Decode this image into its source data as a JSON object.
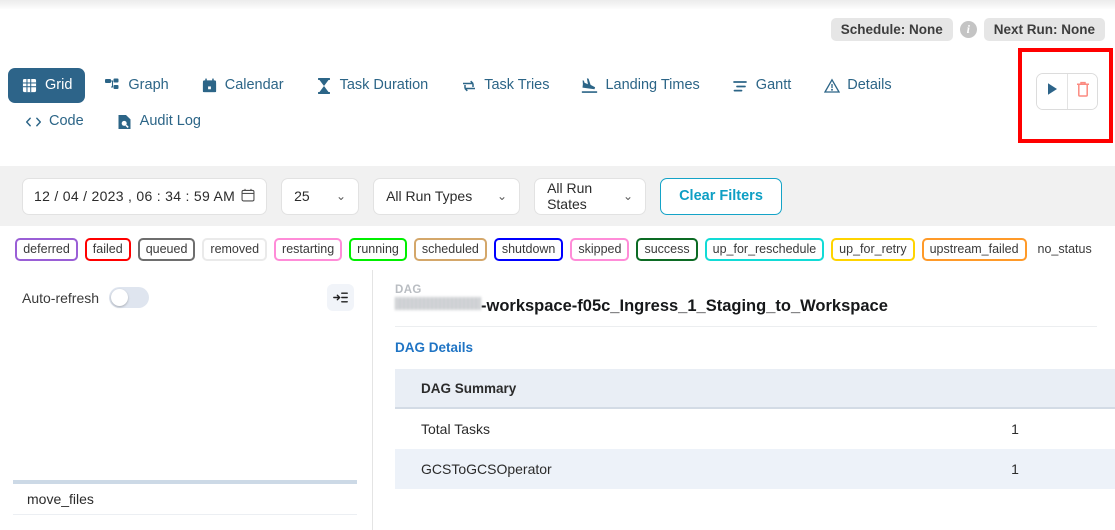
{
  "header": {
    "schedule_badge": "Schedule: None",
    "info_icon": "info-icon",
    "next_run_badge": "Next Run: None"
  },
  "nav": {
    "tabs": [
      {
        "label": "Grid",
        "icon": "grid-icon",
        "active": true
      },
      {
        "label": "Graph",
        "icon": "graph-icon",
        "active": false
      },
      {
        "label": "Calendar",
        "icon": "calendar-icon",
        "active": false
      },
      {
        "label": "Task Duration",
        "icon": "hourglass-icon",
        "active": false
      },
      {
        "label": "Task Tries",
        "icon": "retry-icon",
        "active": false
      },
      {
        "label": "Landing Times",
        "icon": "landing-icon",
        "active": false
      },
      {
        "label": "Gantt",
        "icon": "gantt-icon",
        "active": false
      },
      {
        "label": "Details",
        "icon": "warning-triangle-icon",
        "active": false
      }
    ],
    "tabs_row2": [
      {
        "label": "Code",
        "icon": "code-icon",
        "active": false
      },
      {
        "label": "Audit Log",
        "icon": "audit-log-icon",
        "active": false
      }
    ]
  },
  "actions": {
    "trigger_icon": "play-icon",
    "delete_icon": "trash-icon",
    "highlight_color": "#ff0000"
  },
  "filters": {
    "date_value": "12 / 04 / 2023 ,  06 : 34 : 59   AM",
    "date_icon": "calendar-icon",
    "run_limit": "25",
    "run_types": "All Run Types",
    "run_states": "All Run States",
    "clear_label": "Clear Filters"
  },
  "legend": [
    {
      "label": "deferred",
      "color": "#9a5fd6"
    },
    {
      "label": "failed",
      "color": "#ff0000"
    },
    {
      "label": "queued",
      "color": "#6e6e6e"
    },
    {
      "label": "removed",
      "color": "#eaeaea"
    },
    {
      "label": "restarting",
      "color": "#ff8cd8"
    },
    {
      "label": "running",
      "color": "#00ef00"
    },
    {
      "label": "scheduled",
      "color": "#d4a76a"
    },
    {
      "label": "shutdown",
      "color": "#0000ff"
    },
    {
      "label": "skipped",
      "color": "#ff8cd8"
    },
    {
      "label": "success",
      "color": "#0c6b24"
    },
    {
      "label": "up_for_reschedule",
      "color": "#12dbd6"
    },
    {
      "label": "up_for_retry",
      "color": "#ffd400"
    },
    {
      "label": "upstream_failed",
      "color": "#ff9a29"
    },
    {
      "label": "no_status",
      "color": "transparent"
    }
  ],
  "grid_panel": {
    "auto_refresh_label": "Auto-refresh",
    "auto_refresh_on": false,
    "collapse_icon": "collapse-panel-icon",
    "task_name": "move_files"
  },
  "details_panel": {
    "kicker": "DAG",
    "dag_name_redacted_prefix": true,
    "dag_name": "-workspace-f05c_Ingress_1_Staging_to_Workspace",
    "dag_details_link": "DAG Details",
    "table": {
      "header": {
        "label": "DAG Summary",
        "value": ""
      },
      "rows": [
        {
          "label": "Total Tasks",
          "value": "1"
        },
        {
          "label": "GCSToGCSOperator",
          "value": "1"
        }
      ]
    }
  }
}
